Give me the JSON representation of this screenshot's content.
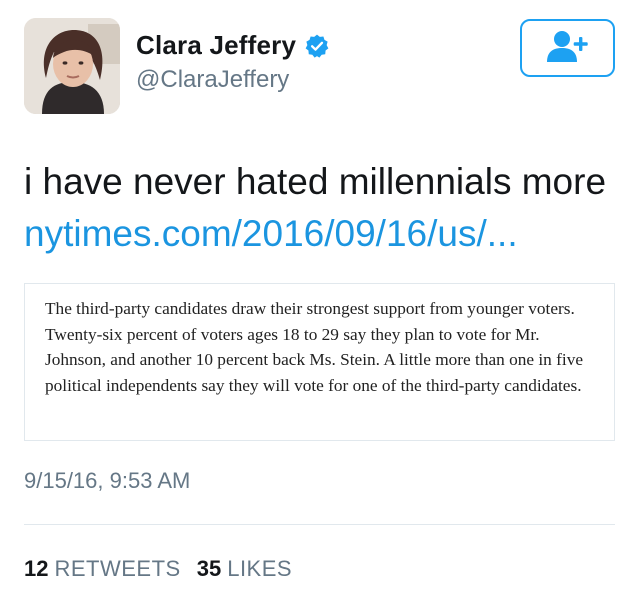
{
  "user": {
    "name": "Clara Jeffery",
    "handle": "@ClaraJeffery"
  },
  "tweet": {
    "text": "i have never hated millennials more",
    "link": "nytimes.com/2016/09/16/us/...",
    "quote": "The third-party candidates draw their strongest support from younger voters. Twenty-six percent of voters ages 18 to 29 say they plan to vote for Mr. Johnson, and another 10 percent back Ms. Stein. A little more than one in five political independents say they will vote for one of the third-party candidates.",
    "timestamp": "9/15/16, 9:53 AM"
  },
  "stats": {
    "retweets_count": "12",
    "retweets_label": "RETWEETS",
    "likes_count": "35",
    "likes_label": "LIKES"
  },
  "colors": {
    "accent": "#1da1f2",
    "link": "#1b95e0",
    "secondary_text": "#657786"
  },
  "icons": {
    "follow": "add-user-icon",
    "verified": "verified-badge-icon"
  }
}
